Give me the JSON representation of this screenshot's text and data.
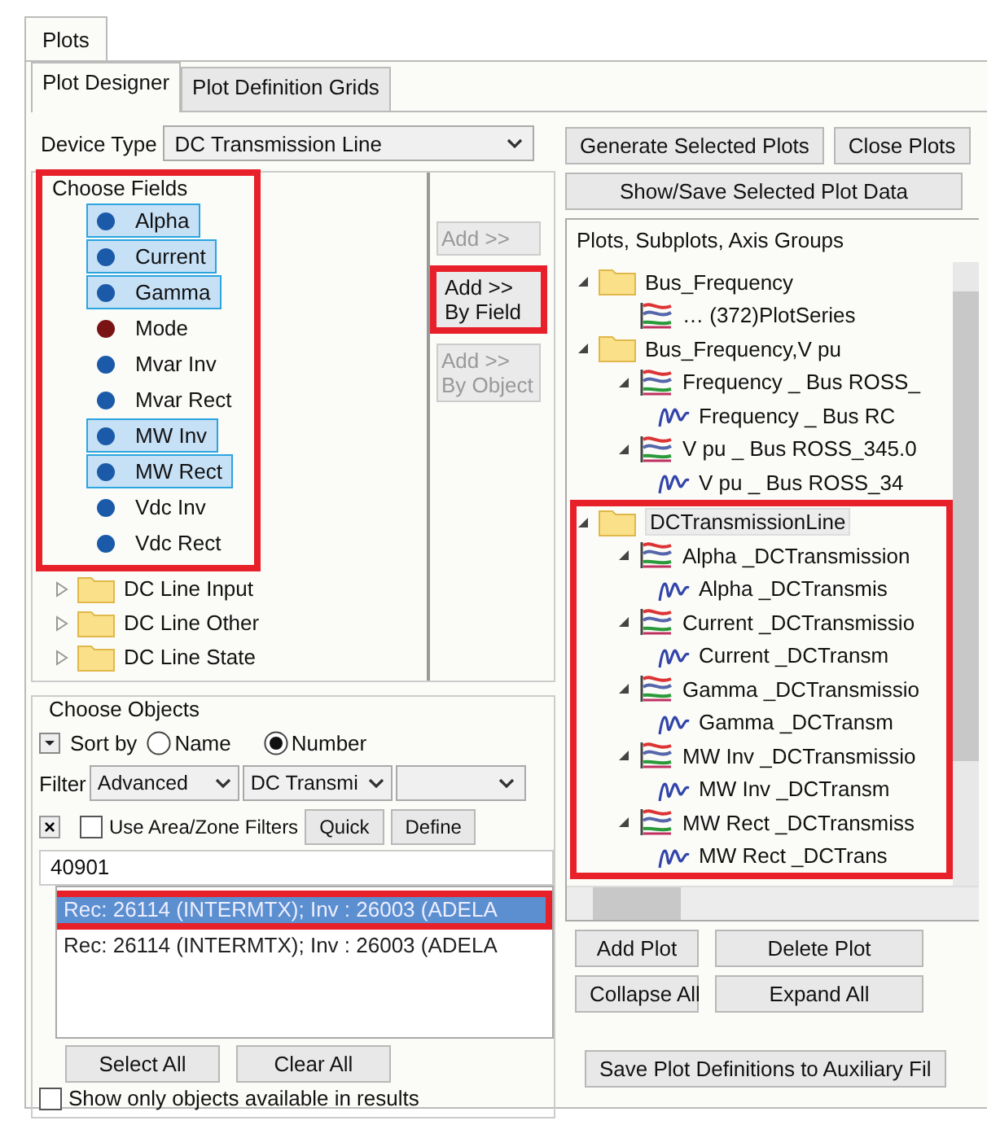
{
  "outer_tabs": [
    {
      "label": "Plots",
      "selected": true
    }
  ],
  "inner_tabs": [
    {
      "label": "Plot Designer",
      "selected": true
    },
    {
      "label": "Plot Definition Grids",
      "selected": false
    }
  ],
  "device_type": {
    "label": "Device Type",
    "value": "DC Transmission Line"
  },
  "choose_fields": {
    "label": "Choose Fields",
    "highlighted": true,
    "items": [
      {
        "kind": "field",
        "label": "Alpha",
        "color": "#1a5aa8",
        "selected": true
      },
      {
        "kind": "field",
        "label": "Current",
        "color": "#1a5aa8",
        "selected": true
      },
      {
        "kind": "field",
        "label": "Gamma",
        "color": "#1a5aa8",
        "selected": true
      },
      {
        "kind": "field",
        "label": "Mode",
        "color": "#7a1414",
        "selected": false
      },
      {
        "kind": "field",
        "label": "Mvar Inv",
        "color": "#1a5aa8",
        "selected": false
      },
      {
        "kind": "field",
        "label": "Mvar Rect",
        "color": "#1a5aa8",
        "selected": false
      },
      {
        "kind": "field",
        "label": "MW Inv",
        "color": "#1a5aa8",
        "selected": true
      },
      {
        "kind": "field",
        "label": "MW Rect",
        "color": "#1a5aa8",
        "selected": true
      },
      {
        "kind": "field",
        "label": "Vdc Inv",
        "color": "#1a5aa8",
        "selected": false
      },
      {
        "kind": "field",
        "label": "Vdc Rect",
        "color": "#1a5aa8",
        "selected": false
      }
    ],
    "folders": [
      {
        "kind": "folder",
        "label": "DC Line Input",
        "expanded": false
      },
      {
        "kind": "folder",
        "label": "DC Line Other",
        "expanded": false
      },
      {
        "kind": "folder",
        "label": "DC Line State",
        "expanded": false
      }
    ]
  },
  "add_buttons": [
    {
      "lines": [
        "Add >>"
      ],
      "disabled": true
    },
    {
      "lines": [
        "Add >>",
        "By Field"
      ],
      "disabled": false,
      "highlighted": true
    },
    {
      "lines": [
        "Add >>",
        "By Object"
      ],
      "disabled": true
    }
  ],
  "choose_objects": {
    "label": "Choose Objects",
    "sort_label": "Sort by",
    "sort_options": [
      {
        "label": "Name",
        "selected": false
      },
      {
        "label": "Number",
        "selected": true
      }
    ],
    "filter_label": "Filter",
    "filter_selects": [
      "Advanced",
      "DC Transmi"
    ],
    "clear_button": "×",
    "area_zone": {
      "label": "Use Area/Zone Filters",
      "checked": false
    },
    "filter_buttons": [
      "Quick",
      "Define"
    ],
    "search_value": "40901",
    "objects": [
      {
        "label": "Rec: 26114 (INTERMTX); Inv : 26003 (ADELA",
        "selected": true,
        "highlighted": true
      },
      {
        "label": "Rec: 26114 (INTERMTX); Inv : 26003 (ADELA",
        "selected": false
      }
    ],
    "buttons": [
      "Select All",
      "Clear All"
    ],
    "available_only": {
      "label": "Show only objects available in results",
      "checked": false
    }
  },
  "top_buttons": [
    "Generate Selected Plots",
    "Close Plots"
  ],
  "show_save_button": "Show/Save Selected Plot Data",
  "plots_tree": {
    "title": "Plots, Subplots, Axis Groups",
    "nodes": [
      {
        "kind": "folder",
        "label": "Bus_Frequency",
        "expanded": true,
        "selected": false,
        "children": [
          {
            "kind": "plot",
            "label": "… (372)PlotSeries",
            "expanded": false
          }
        ]
      },
      {
        "kind": "folder",
        "label": "Bus_Frequency,V pu",
        "expanded": true,
        "selected": false,
        "children": [
          {
            "kind": "plot",
            "label": "Frequency _ Bus ROSS_",
            "expanded": true,
            "children": [
              {
                "kind": "series",
                "label": "Frequency _ Bus RC"
              }
            ]
          },
          {
            "kind": "plot",
            "label": "V pu _ Bus ROSS_345.0",
            "expanded": true,
            "children": [
              {
                "kind": "series",
                "label": "V pu _ Bus ROSS_34"
              }
            ]
          }
        ]
      },
      {
        "kind": "folder",
        "label": "DCTransmissionLine",
        "expanded": true,
        "highlighted": true,
        "selected": true,
        "children": [
          {
            "kind": "plot",
            "label": "Alpha _DCTransmission",
            "expanded": true,
            "children": [
              {
                "kind": "series",
                "label": "Alpha _DCTransmis"
              }
            ]
          },
          {
            "kind": "plot",
            "label": "Current _DCTransmissio",
            "expanded": true,
            "children": [
              {
                "kind": "series",
                "label": "Current _DCTransm"
              }
            ]
          },
          {
            "kind": "plot",
            "label": "Gamma _DCTransmissio",
            "expanded": true,
            "children": [
              {
                "kind": "series",
                "label": "Gamma _DCTransm"
              }
            ]
          },
          {
            "kind": "plot",
            "label": "MW Inv _DCTransmissio",
            "expanded": true,
            "children": [
              {
                "kind": "series",
                "label": "MW Inv _DCTransm"
              }
            ]
          },
          {
            "kind": "plot",
            "label": "MW Rect _DCTransmiss",
            "expanded": true,
            "children": [
              {
                "kind": "series",
                "label": "MW Rect _DCTrans"
              }
            ]
          }
        ]
      }
    ]
  },
  "plot_buttons": [
    "Add Plot",
    "Delete Plot",
    "Collapse All",
    "Expand All"
  ],
  "save_button": "Save Plot Definitions to Auxiliary Fil"
}
